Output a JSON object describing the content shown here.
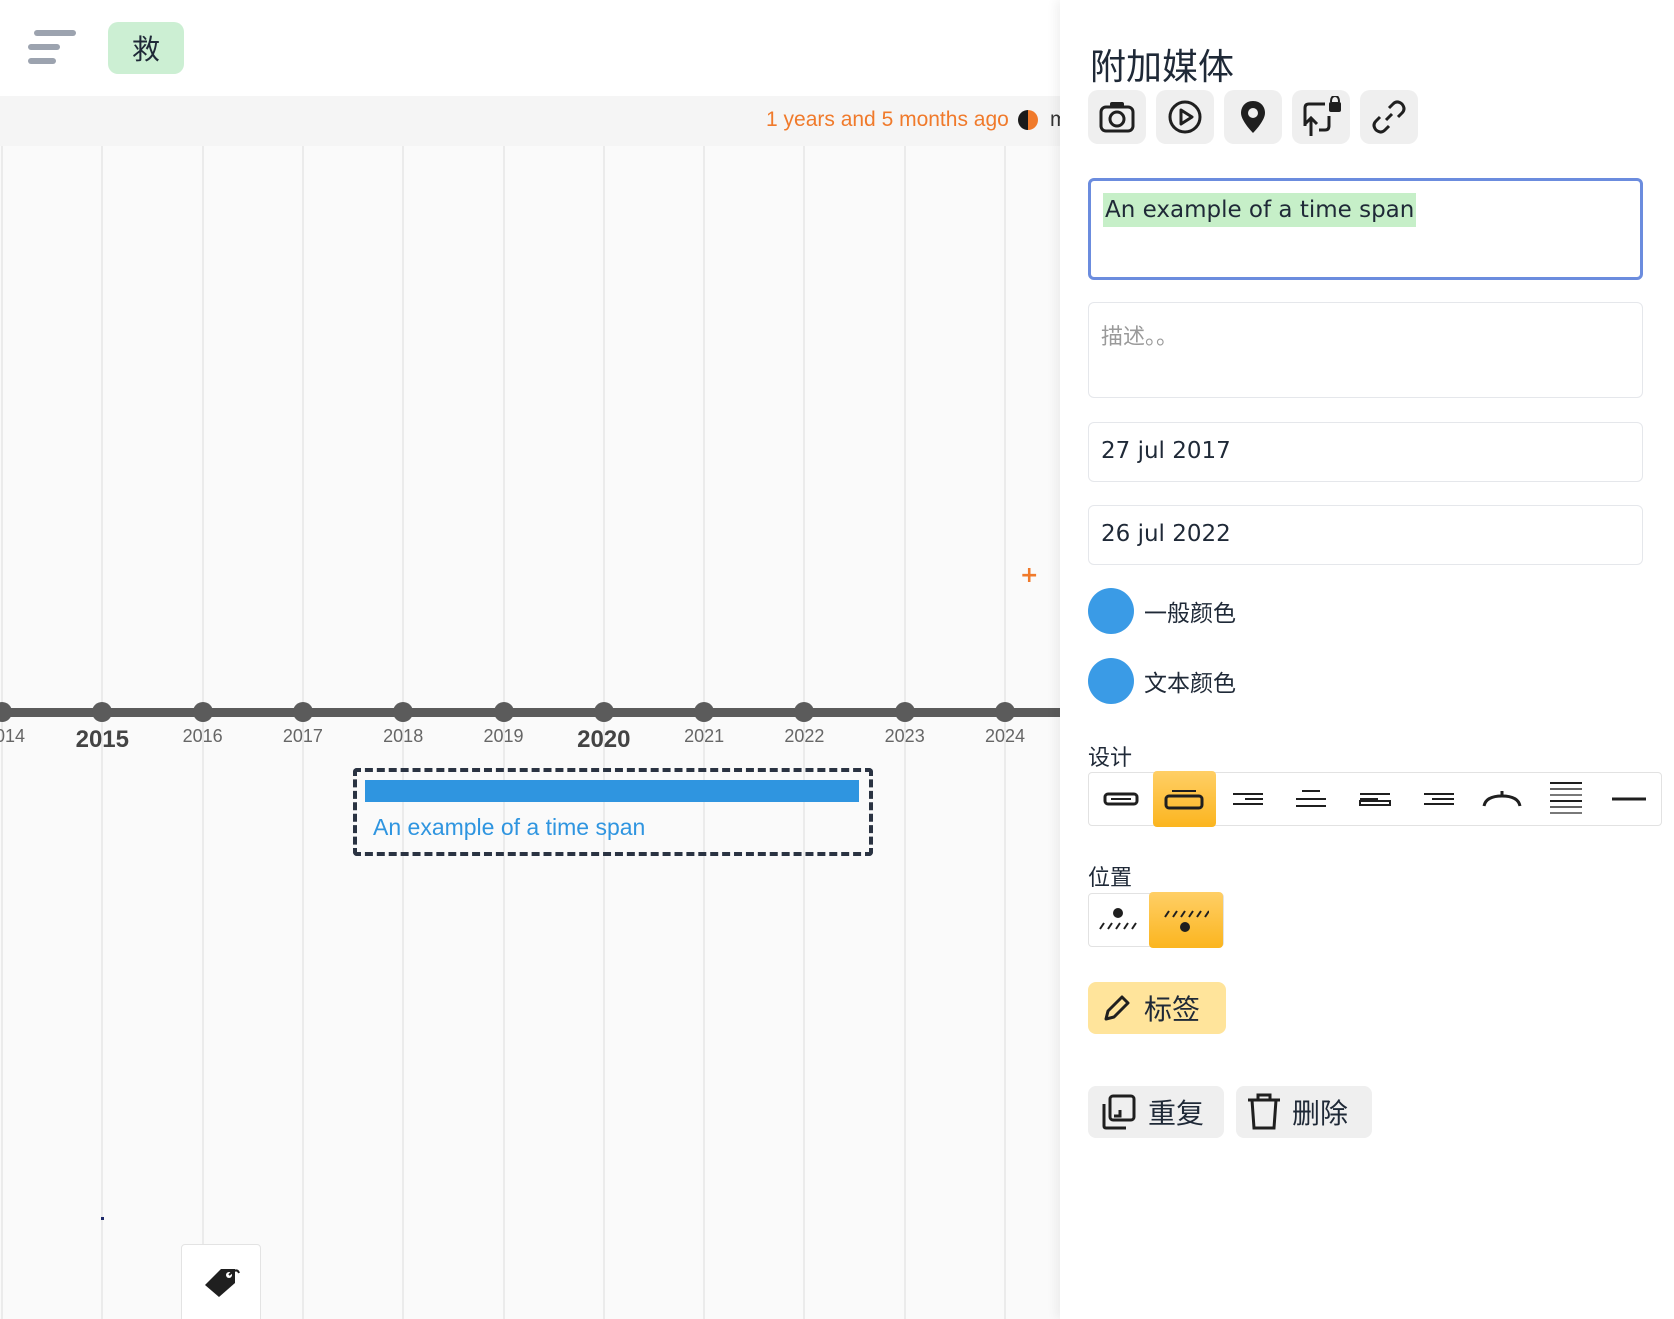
{
  "toolbar": {
    "save_label": "救"
  },
  "timeline": {
    "status_text": "1 years and 5 months ago",
    "status_more": "m",
    "axis_years": [
      {
        "label": "014",
        "major": false
      },
      {
        "label": "2015",
        "major": true
      },
      {
        "label": "2016",
        "major": false
      },
      {
        "label": "2017",
        "major": false
      },
      {
        "label": "2018",
        "major": false
      },
      {
        "label": "2019",
        "major": false
      },
      {
        "label": "2020",
        "major": true
      },
      {
        "label": "2021",
        "major": false
      },
      {
        "label": "2022",
        "major": false
      },
      {
        "label": "2023",
        "major": false
      },
      {
        "label": "2024",
        "major": false
      }
    ],
    "event": {
      "label": "An example of a time span",
      "color": "#2f95e0"
    }
  },
  "panel": {
    "title": "附加媒体",
    "media_buttons": [
      "camera-icon",
      "play-icon",
      "location-pin-icon",
      "locked-upload-icon",
      "link-icon"
    ],
    "title_input": {
      "value": "An example of a time span"
    },
    "description_input": {
      "placeholder": "描述。。"
    },
    "start_date": "27 jul 2017",
    "end_date": "26 jul 2022",
    "general_color": {
      "label": "一般颜色",
      "value": "#3a9be6"
    },
    "text_color": {
      "label": "文本颜色",
      "value": "#3a9be6"
    },
    "design_label": "设计",
    "design_options": [
      "bar-outline",
      "bar-outline-raised",
      "bar-lines-right",
      "bar-lines-top",
      "bar-lines-left",
      "bar-lines-center",
      "bracket",
      "dotted-grid",
      "line"
    ],
    "design_selected": 1,
    "position_label": "位置",
    "position_options": [
      "dot-above",
      "dot-below"
    ],
    "position_selected": 1,
    "tag_button": "标签",
    "duplicate_button": "重复",
    "delete_button": "删除"
  },
  "colors": {
    "accent_orange": "#f07a2b",
    "active_yellow": "#fbb51f",
    "event_blue": "#2f95e0"
  }
}
